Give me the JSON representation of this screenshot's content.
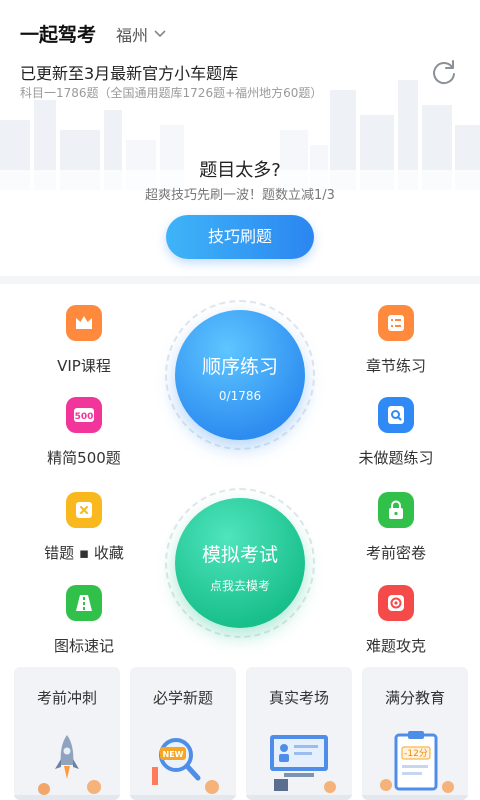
{
  "header": {
    "app_name": "一起驾考",
    "city": "福州",
    "update_title": "已更新至3月最新官方小车题库",
    "update_sub": "科目一1786题（全国通用题库1726题+福州地方60题）"
  },
  "promo": {
    "title": "题目太多?",
    "subtitle": "超爽技巧先刷一波！题数立减1/3",
    "button": "技巧刷题"
  },
  "features": {
    "vip": {
      "label": "VIP课程",
      "icon": "crown-icon",
      "color": "#ff8a3d"
    },
    "chapter": {
      "label": "章节练习",
      "icon": "list-icon",
      "color": "#ff8a3d"
    },
    "simplified": {
      "label": "精简500题",
      "icon": "badge-500-icon",
      "color": "#f2359a",
      "badge": "500"
    },
    "undone": {
      "label": "未做题练习",
      "icon": "search-doc-icon",
      "color": "#2f8af5"
    },
    "wrong": {
      "label": "错题 ▪ 收藏",
      "icon": "wrong-note-icon",
      "color": "#f8b81e"
    },
    "secret": {
      "label": "考前密卷",
      "icon": "lock-icon",
      "color": "#31c04a"
    },
    "signs": {
      "label": "图标速记",
      "icon": "road-icon",
      "color": "#31c04a"
    },
    "hard": {
      "label": "难题攻克",
      "icon": "target-icon",
      "color": "#f44a4a"
    }
  },
  "practice": {
    "title": "顺序练习",
    "progress": "0/1786",
    "progress_done": 0,
    "progress_total": 1786
  },
  "exam": {
    "title": "模拟考试",
    "subtitle": "点我去模考"
  },
  "cards": [
    {
      "title": "考前冲刺",
      "icon": "rocket-icon"
    },
    {
      "title": "必学新题",
      "icon": "new-magnifier-icon",
      "badge": "NEW"
    },
    {
      "title": "真实考场",
      "icon": "exam-room-icon"
    },
    {
      "title": "满分教育",
      "icon": "score-clipboard-icon",
      "badge": "-12分"
    }
  ]
}
